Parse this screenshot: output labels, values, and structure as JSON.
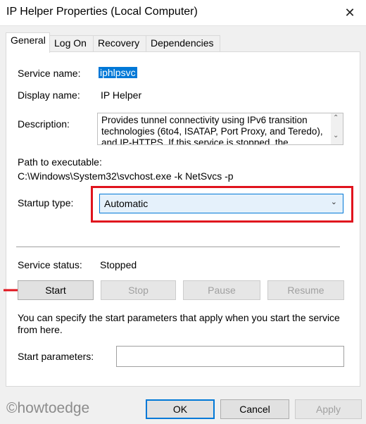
{
  "window": {
    "title": "IP Helper Properties (Local Computer)",
    "close_glyph": "✕"
  },
  "tabs": [
    {
      "label": "General",
      "active": true
    },
    {
      "label": "Log On",
      "active": false
    },
    {
      "label": "Recovery",
      "active": false
    },
    {
      "label": "Dependencies",
      "active": false
    }
  ],
  "general": {
    "service_name_label": "Service name:",
    "service_name_value": "iphlpsvc",
    "display_name_label": "Display name:",
    "display_name_value": "IP Helper",
    "description_label": "Description:",
    "description_value": "Provides tunnel connectivity using IPv6 transition technologies (6to4, ISATAP, Port Proxy, and Teredo), and IP-HTTPS. If this service is stopped, the",
    "path_label": "Path to executable:",
    "path_value": "C:\\Windows\\System32\\svchost.exe -k NetSvcs -p",
    "startup_type_label": "Startup type:",
    "startup_type_value": "Automatic",
    "service_status_label": "Service status:",
    "service_status_value": "Stopped",
    "start_button": "Start",
    "stop_button": "Stop",
    "pause_button": "Pause",
    "resume_button": "Resume",
    "hint_line1": "You can specify the start parameters that apply when you start the service",
    "hint_line2": "from here.",
    "start_params_label": "Start parameters:",
    "start_params_value": ""
  },
  "footer": {
    "ok_button": "OK",
    "cancel_button": "Cancel",
    "apply_button": "Apply"
  },
  "watermark": "©howtoedge",
  "colors": {
    "highlight_box": "#e0141e",
    "selection": "#0078d7",
    "arrow": "#e0141e"
  }
}
